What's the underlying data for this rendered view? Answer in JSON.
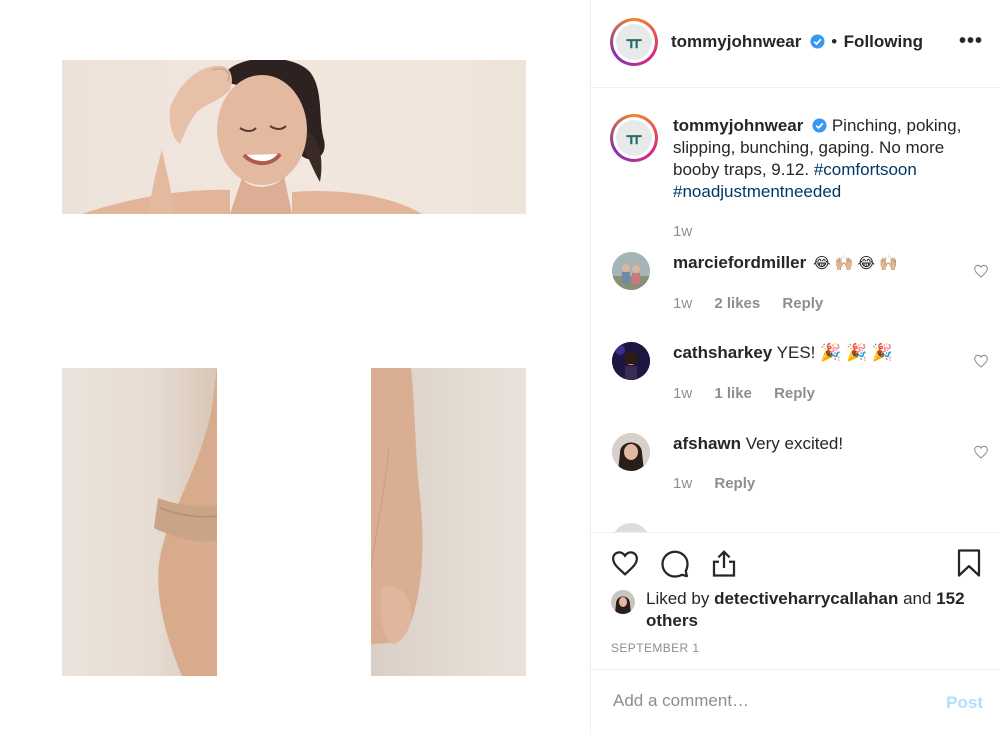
{
  "post": {
    "account": "tommyjohnwear",
    "separator": "•",
    "following_label": "Following",
    "more_label": "•••",
    "logo_letter": "ㅠ"
  },
  "caption": {
    "username": "tommyjohnwear",
    "text": "Pinching, poking, slipping, bunching, gaping. No more booby traps, 9.12.",
    "hashtag1": "#comfortsoon",
    "hashtag2": "#noadjustmentneeded",
    "time": "1w"
  },
  "comments": [
    {
      "username": "marciefordmiller",
      "text": "😂 🙌🏼 😂 🙌🏼",
      "time": "1w",
      "likes": "2 likes",
      "reply": "Reply"
    },
    {
      "username": "cathsharkey",
      "text": "YES! 🎉 🎉 🎉",
      "time": "1w",
      "likes": "1 like",
      "reply": "Reply"
    },
    {
      "username": "afshawn",
      "text": "Very excited!",
      "time": "1w",
      "likes": "",
      "reply": "Reply"
    }
  ],
  "likes": {
    "prefix": "Liked by",
    "user": "detectiveharrycallahan",
    "conj": "and",
    "others": "152 others"
  },
  "date": "SEPTEMBER 1",
  "add_comment": {
    "placeholder": "Add a comment…",
    "post_label": "Post"
  },
  "colors": {
    "link": "#00376b",
    "verified": "#3897f0",
    "post_disabled": "#b2dffc",
    "muted": "#8e8e8e"
  }
}
